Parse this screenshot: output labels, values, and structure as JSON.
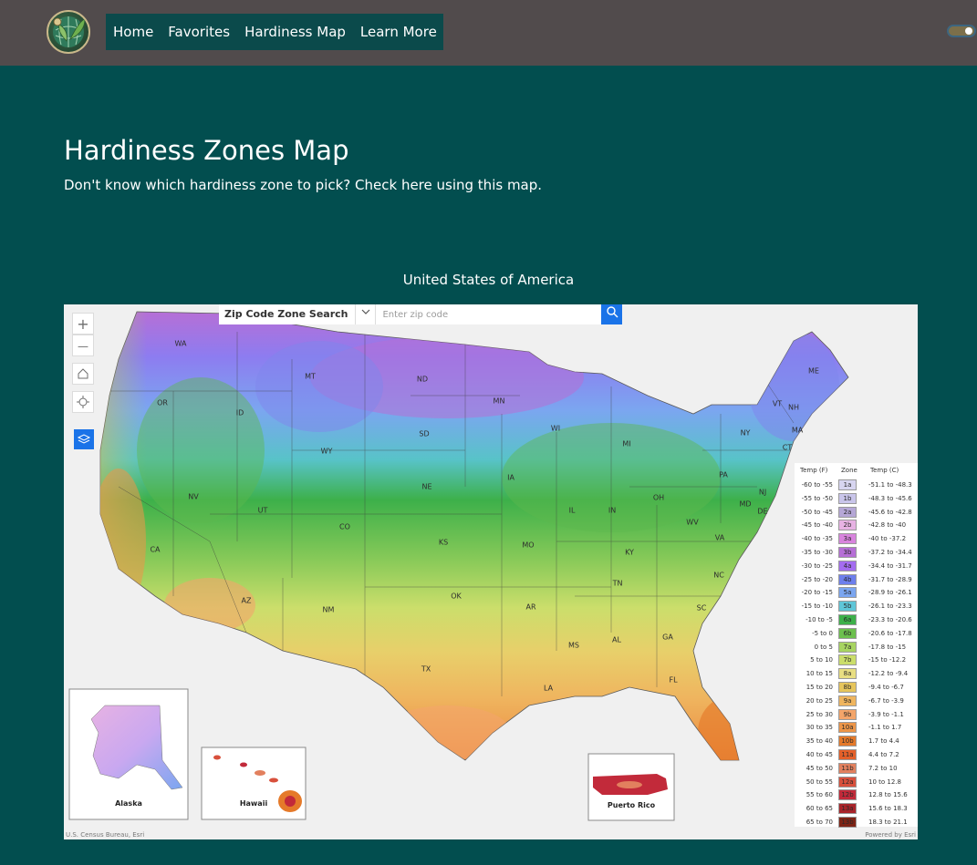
{
  "nav": {
    "links": [
      "Home",
      "Favorites",
      "Hardiness Map",
      "Learn More"
    ]
  },
  "hero": {
    "title": "Hardiness Zones Map",
    "subtitle": "Don't know which hardiness zone to pick? Check here using this map."
  },
  "map": {
    "country_label": "United States of America",
    "zip_search": {
      "label": "Zip Code Zone Search",
      "placeholder": "Enter zip code"
    },
    "controls": {
      "zoom_in": "+",
      "zoom_out": "—"
    },
    "state_labels": [
      "WA",
      "OR",
      "CA",
      "NV",
      "ID",
      "MT",
      "WY",
      "UT",
      "AZ",
      "CO",
      "NM",
      "ND",
      "SD",
      "NE",
      "KS",
      "OK",
      "TX",
      "MN",
      "IA",
      "MO",
      "AR",
      "LA",
      "WI",
      "IL",
      "MI",
      "IN",
      "OH",
      "KY",
      "TN",
      "MS",
      "AL",
      "GA",
      "FL",
      "SC",
      "NC",
      "VA",
      "WV",
      "PA",
      "NY",
      "VT",
      "NH",
      "ME",
      "MA",
      "CT",
      "NJ",
      "DE",
      "MD"
    ],
    "insets": {
      "alaska": "Alaska",
      "hawaii": "Hawaii",
      "puerto_rico": "Puerto Rico"
    },
    "attribution_left": "U.S. Census Bureau, Esri",
    "attribution_right": "Powered by Esri"
  },
  "legend": {
    "headers": {
      "temp_f": "Temp (F)",
      "zone": "Zone",
      "temp_c": "Temp (C)"
    },
    "rows": [
      {
        "temp_f": "-60 to -55",
        "zone": "1a",
        "temp_c": "-51.1 to -48.3",
        "color": "#d7d5f0"
      },
      {
        "temp_f": "-55 to -50",
        "zone": "1b",
        "temp_c": "-48.3 to -45.6",
        "color": "#c9c5ea"
      },
      {
        "temp_f": "-50 to -45",
        "zone": "2a",
        "temp_c": "-45.6 to -42.8",
        "color": "#b5a7d6"
      },
      {
        "temp_f": "-45 to -40",
        "zone": "2b",
        "temp_c": "-42.8 to -40",
        "color": "#e7b2e3"
      },
      {
        "temp_f": "-40 to -35",
        "zone": "3a",
        "temp_c": "-40 to -37.2",
        "color": "#d884dd"
      },
      {
        "temp_f": "-35 to -30",
        "zone": "3b",
        "temp_c": "-37.2 to -34.4",
        "color": "#b66fd6"
      },
      {
        "temp_f": "-30 to -25",
        "zone": "4a",
        "temp_c": "-34.4 to -31.7",
        "color": "#a46cf0"
      },
      {
        "temp_f": "-25 to -20",
        "zone": "4b",
        "temp_c": "-31.7 to -28.9",
        "color": "#6d7fec"
      },
      {
        "temp_f": "-20 to -15",
        "zone": "5a",
        "temp_c": "-28.9 to -26.1",
        "color": "#7ba6f0"
      },
      {
        "temp_f": "-15 to -10",
        "zone": "5b",
        "temp_c": "-26.1 to -23.3",
        "color": "#5fc6d8"
      },
      {
        "temp_f": "-10 to -5",
        "zone": "6a",
        "temp_c": "-23.3 to -20.6",
        "color": "#3db04a"
      },
      {
        "temp_f": "-5 to 0",
        "zone": "6b",
        "temp_c": "-20.6 to -17.8",
        "color": "#6cc04e"
      },
      {
        "temp_f": "0 to 5",
        "zone": "7a",
        "temp_c": "-17.8 to -15",
        "color": "#a7d461"
      },
      {
        "temp_f": "5 to 10",
        "zone": "7b",
        "temp_c": "-15 to -12.2",
        "color": "#cbde6b"
      },
      {
        "temp_f": "10 to 15",
        "zone": "8a",
        "temp_c": "-12.2 to -9.4",
        "color": "#e8de82"
      },
      {
        "temp_f": "15 to 20",
        "zone": "8b",
        "temp_c": "-9.4 to -6.7",
        "color": "#e6c55c"
      },
      {
        "temp_f": "20 to 25",
        "zone": "9a",
        "temp_c": "-6.7 to -3.9",
        "color": "#efb55f"
      },
      {
        "temp_f": "25 to 30",
        "zone": "9b",
        "temp_c": "-3.9 to -1.1",
        "color": "#f3a56a"
      },
      {
        "temp_f": "30 to 35",
        "zone": "10a",
        "temp_c": "-1.1 to 1.7",
        "color": "#ec9548"
      },
      {
        "temp_f": "35 to 40",
        "zone": "10b",
        "temp_c": "1.7 to 4.4",
        "color": "#e57a2a"
      },
      {
        "temp_f": "40 to 45",
        "zone": "11a",
        "temp_c": "4.4 to 7.2",
        "color": "#e4602a"
      },
      {
        "temp_f": "45 to 50",
        "zone": "11b",
        "temp_c": "7.2 to 10",
        "color": "#e2805e"
      },
      {
        "temp_f": "50 to 55",
        "zone": "12a",
        "temp_c": "10 to 12.8",
        "color": "#d8503c"
      },
      {
        "temp_f": "55 to 60",
        "zone": "12b",
        "temp_c": "12.8 to 15.6",
        "color": "#c22a3a"
      },
      {
        "temp_f": "60 to 65",
        "zone": "13a",
        "temp_c": "15.6 to 18.3",
        "color": "#a8242a"
      },
      {
        "temp_f": "65 to 70",
        "zone": "13b",
        "temp_c": "18.3 to 21.1",
        "color": "#7e2415"
      }
    ]
  },
  "colors": {
    "nav_bg": "#514b4c",
    "nav_links_bg": "#0b4a4b",
    "page_bg": "#024e4f",
    "accent_blue": "#1a73e8"
  },
  "icons": {
    "zoom_in": "plus-icon",
    "zoom_out": "minus-icon",
    "home": "home-icon",
    "locate": "locate-icon",
    "layers": "layers-icon",
    "search": "search-icon",
    "chevron": "chevron-down-icon",
    "theme_toggle": "theme-toggle"
  }
}
